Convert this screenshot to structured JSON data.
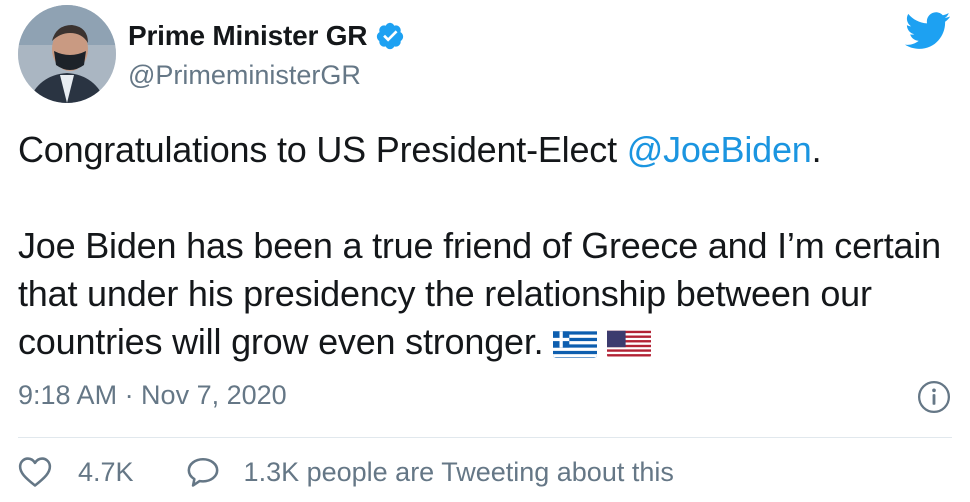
{
  "author": {
    "display_name": "Prime Minister GR",
    "handle": "@PrimeministerGR",
    "verified": true
  },
  "tweet": {
    "line1_prefix": "Congratulations to US President-Elect ",
    "line1_mention": "@JoeBiden",
    "line1_suffix": ".",
    "paragraph2": "Joe Biden has been a true friend of Greece and I’m certain that under his presidency the relationship between our countries will grow even stronger.",
    "flags": [
      "greece-flag-icon",
      "us-flag-icon"
    ]
  },
  "timestamp": "9:18 AM · Nov 7, 2020",
  "engagement": {
    "likes": "4.7K",
    "tweeting": "1.3K people are Tweeting about this"
  },
  "colors": {
    "link": "#1b95e0",
    "muted": "#657786",
    "brand": "#1da1f2",
    "text": "#14171a"
  }
}
